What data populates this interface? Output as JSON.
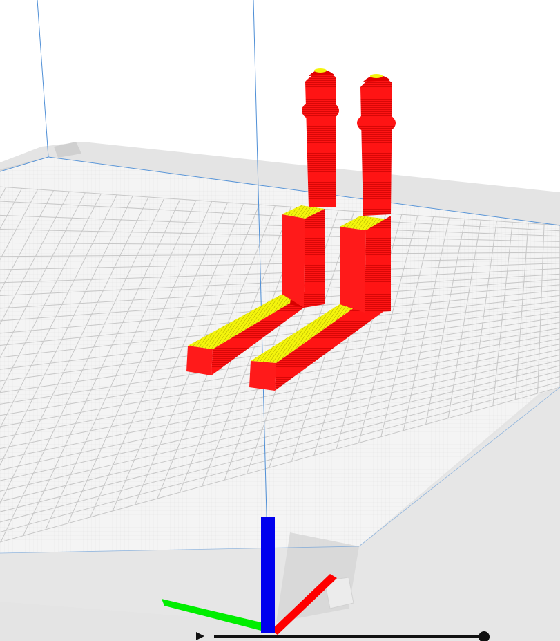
{
  "viewport": {
    "background": "#ffffff",
    "bed": {
      "surface_color": "#f4f4f4",
      "grid_major_color": "#c7c7c7",
      "grid_minor_color": "#e3e3e3",
      "edge_line_color": "#5a96d8",
      "frame_color": "#e2e2e2",
      "frame_shadow_color": "#cdcdcd"
    },
    "model": {
      "wall_color": "#ff1010",
      "wall_shade_color": "#d80000",
      "wall_dark_color": "#b80000",
      "infill_color": "#f2f20a",
      "infill_line_color": "#a6a600"
    },
    "axes": {
      "x_color": "#ff0000",
      "y_color": "#00ee00",
      "z_color": "#0000ee"
    },
    "build_volume_line_color": "#4f8fd6",
    "layer_slider": {
      "track_color": "#111111",
      "handle_icon": "play-icon"
    }
  }
}
